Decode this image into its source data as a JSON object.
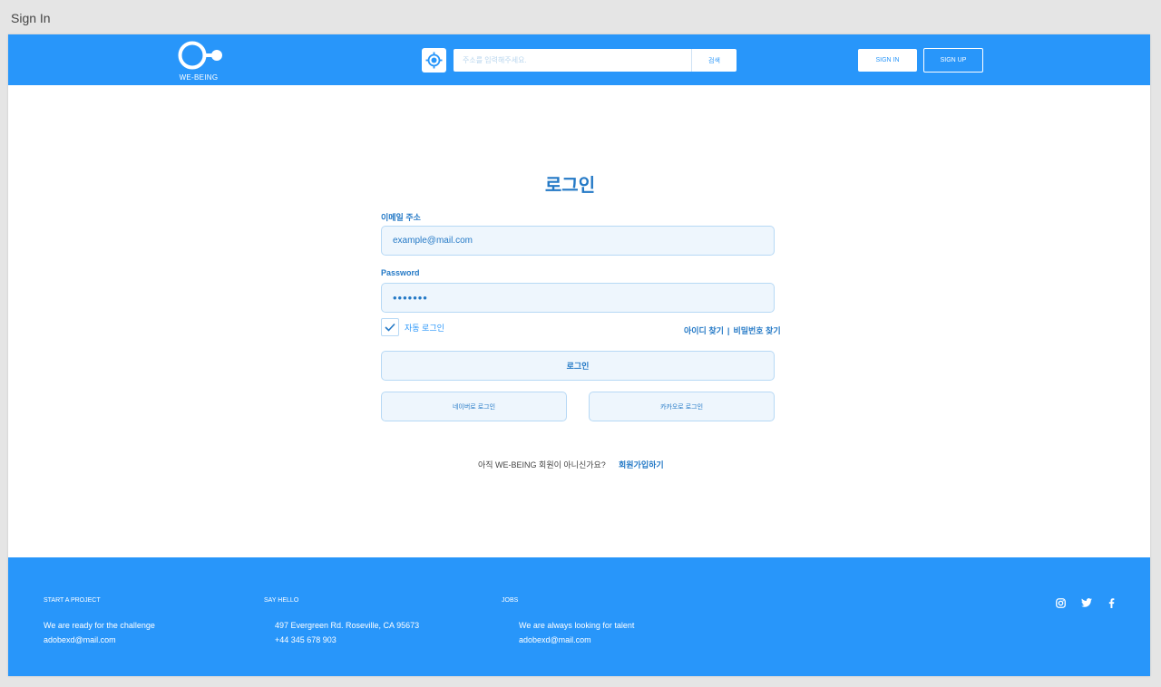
{
  "window": {
    "title": "Sign In"
  },
  "header": {
    "logo_text": "WE-BEING",
    "search_placeholder": "주소를 입력해주세요.",
    "search_button": "검색",
    "signin_button": "SIGN IN",
    "signup_button": "SIGN UP"
  },
  "login": {
    "title": "로그인",
    "email_label": "이메일 주소",
    "email_value": "example@mail.com",
    "password_label": "Password",
    "password_value": "•••••••",
    "auto_login_label": "자동 로그인",
    "auto_login_checked": true,
    "find_id": "아이디 찾기",
    "separator": "|",
    "find_password": "비밀번호 찾기",
    "login_button": "로그인",
    "naver_button": "네이버로 로그인",
    "kakao_button": "카카오로 로그인",
    "signup_prompt": "아직 WE-BEING 회원이 아니신가요?",
    "signup_link": "회원가입하기"
  },
  "footer": {
    "project": {
      "heading": "START A PROJECT",
      "line1": "We are ready for the challenge",
      "line2": "adobexd@mail.com"
    },
    "hello": {
      "heading": "SAY HELLO",
      "line1": "497 Evergreen Rd. Roseville, CA 95673",
      "line2": "+44 345 678 903"
    },
    "jobs": {
      "heading": "JOBS",
      "line1": "We are always looking for talent",
      "line2": "adobexd@mail.com"
    },
    "social_icons": [
      "instagram-icon",
      "twitter-icon",
      "facebook-icon"
    ]
  },
  "colors": {
    "primary": "#2896fa",
    "text_blue": "#2479c6",
    "input_bg": "#eef6fd",
    "input_border": "#b7d9f5"
  }
}
